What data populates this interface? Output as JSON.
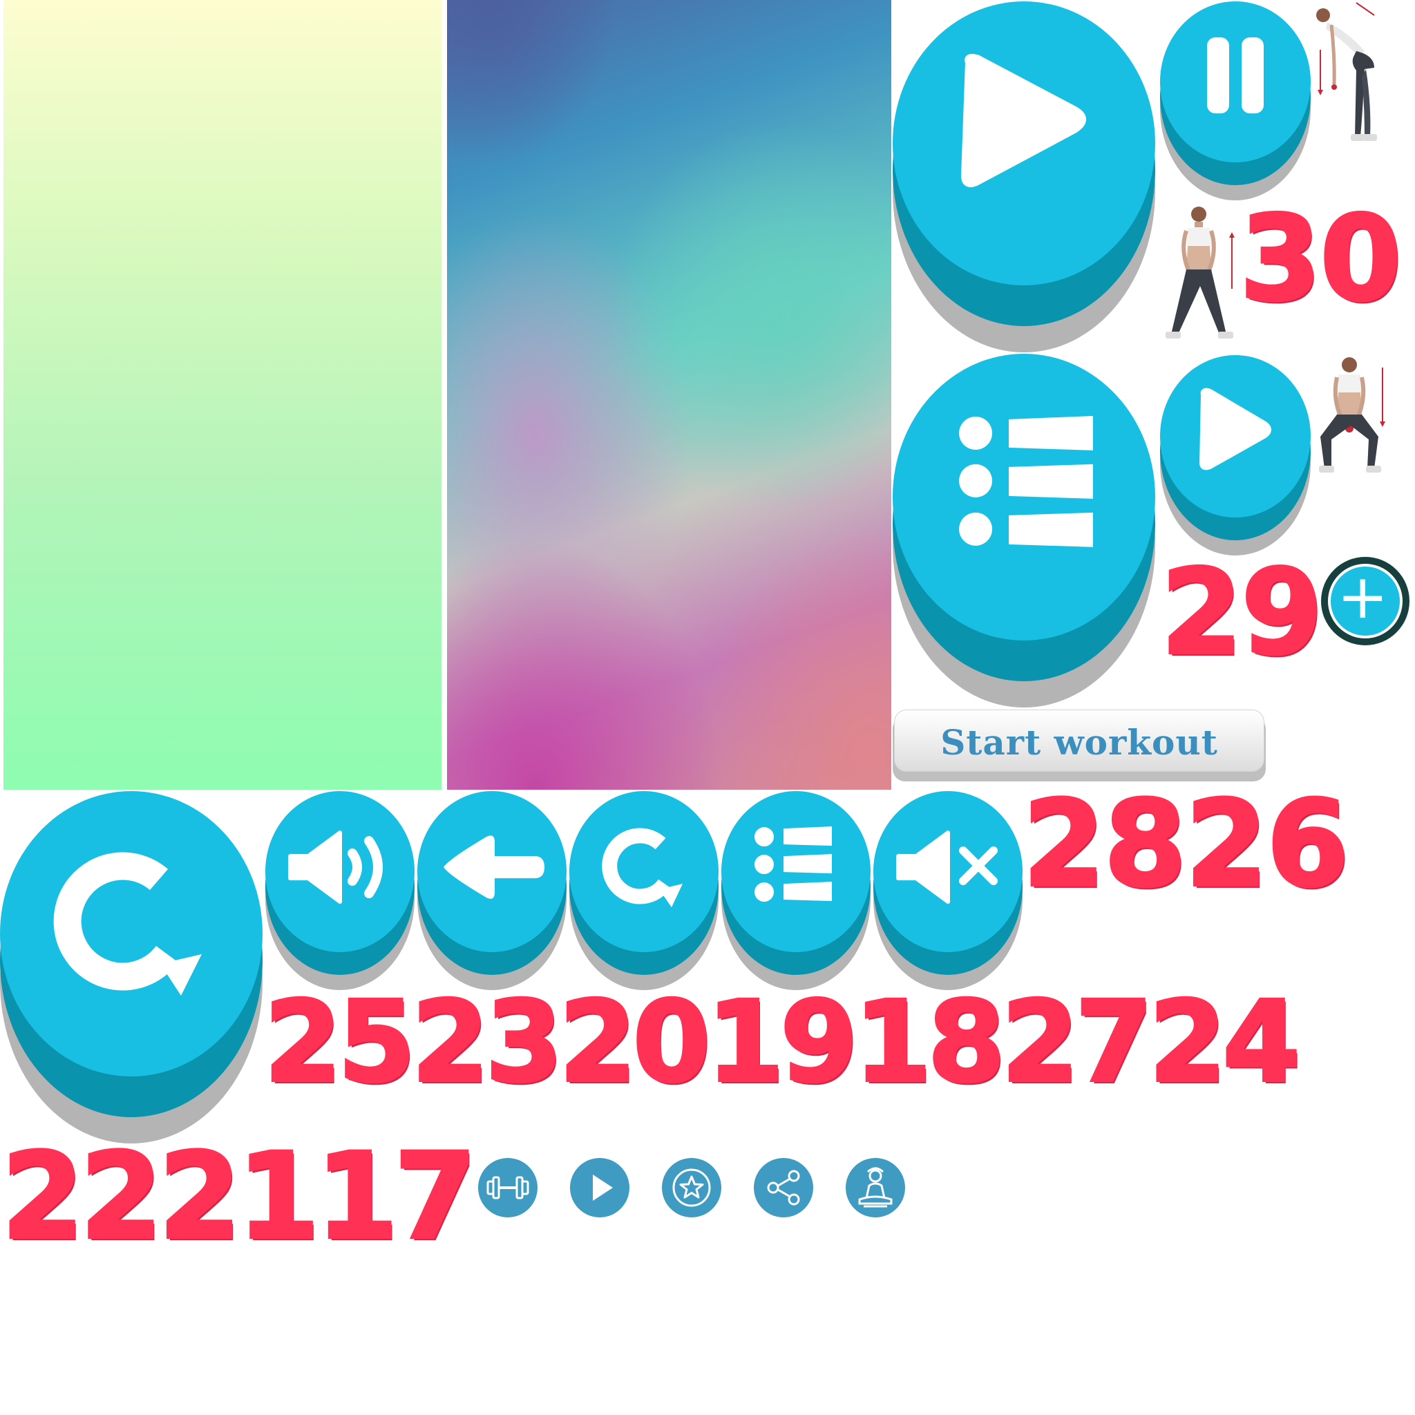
{
  "start_button": {
    "label": "Start workout"
  },
  "numbers": {
    "n30": "30",
    "n29": "29",
    "n2826": "2826",
    "n2523": "25232019182724",
    "n2221": "222117"
  },
  "colors": {
    "button_face": "#19bfe2",
    "button_base": "#0a93ad",
    "button_shadow": "#b4b4b4",
    "number_red": "#ff3155",
    "flat_icon_blue": "#3f9bc1",
    "start_label": "#3a8fbe"
  },
  "icons": [
    "play-icon",
    "pause-icon",
    "list-icon",
    "restart-icon",
    "sound-on-icon",
    "back-arrow-icon",
    "mute-icon",
    "plus-icon",
    "dumbbell-icon",
    "star-icon",
    "share-icon",
    "meditation-icon"
  ]
}
